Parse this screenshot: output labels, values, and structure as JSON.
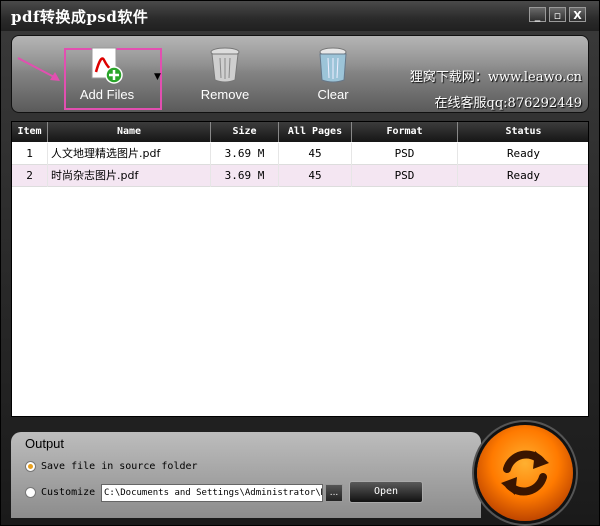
{
  "window": {
    "title": "pdf转换成psd软件",
    "controls": {
      "minimize": "_",
      "restore": "▫",
      "close": "X"
    }
  },
  "toolbar": {
    "add_files_label": "Add Files",
    "remove_label": "Remove",
    "clear_label": "Clear",
    "brand_line1": "狸窝下载网：www.leawo.cn",
    "brand_line2": "在线客服qq:876292449"
  },
  "table": {
    "columns": [
      "Item",
      "Name",
      "Size",
      "All Pages",
      "Format",
      "Status"
    ],
    "rows": [
      {
        "item": "1",
        "name": "人文地理精选图片.pdf",
        "size": "3.69 M",
        "pages": "45",
        "format": "PSD",
        "status": "Ready"
      },
      {
        "item": "2",
        "name": "时尚杂志图片.pdf",
        "size": "3.69 M",
        "pages": "45",
        "format": "PSD",
        "status": "Ready"
      }
    ]
  },
  "output": {
    "title": "Output",
    "option_source": "Save file in source folder",
    "option_customize": "Customize",
    "selected": "source",
    "path": "C:\\Documents and Settings\\Administrator\\M",
    "browse_label": "...",
    "open_label": "Open"
  },
  "colors": {
    "highlight_box": "#e24fb0",
    "row_alt": "#f4e6f2",
    "accent_orange": "#ff7a00"
  },
  "icons": {
    "add_files": "pdf-add-icon",
    "remove": "trash-icon",
    "clear": "clear-bin-icon",
    "convert": "convert-refresh-icon"
  }
}
